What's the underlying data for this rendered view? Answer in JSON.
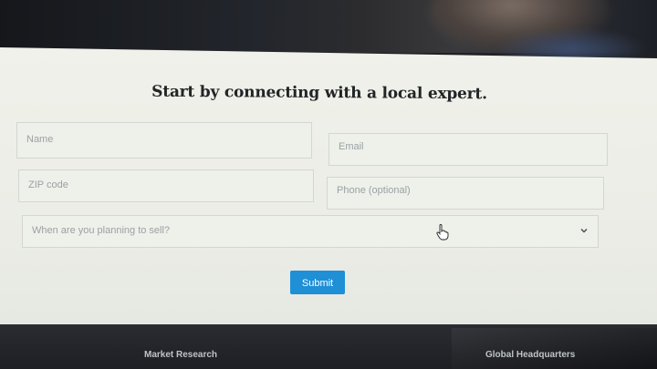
{
  "form": {
    "headline": "Start by connecting with a local expert.",
    "fields": {
      "name": {
        "placeholder": "Name"
      },
      "email": {
        "placeholder": "Email"
      },
      "zip": {
        "placeholder": "ZIP code"
      },
      "phone": {
        "placeholder": "Phone (optional)"
      },
      "sell_timing": {
        "placeholder": "When are you planning to sell?"
      }
    },
    "submit_label": "Submit"
  },
  "footer": {
    "links": [
      "Market Research",
      "Global Headquarters"
    ]
  },
  "colors": {
    "accent": "#1f8fd6",
    "panel_bg": "#eef0ea",
    "footer_bg": "#1f2126"
  },
  "icons": {
    "dropdown": "chevron-down-icon",
    "cursor": "hand-pointer-icon"
  }
}
